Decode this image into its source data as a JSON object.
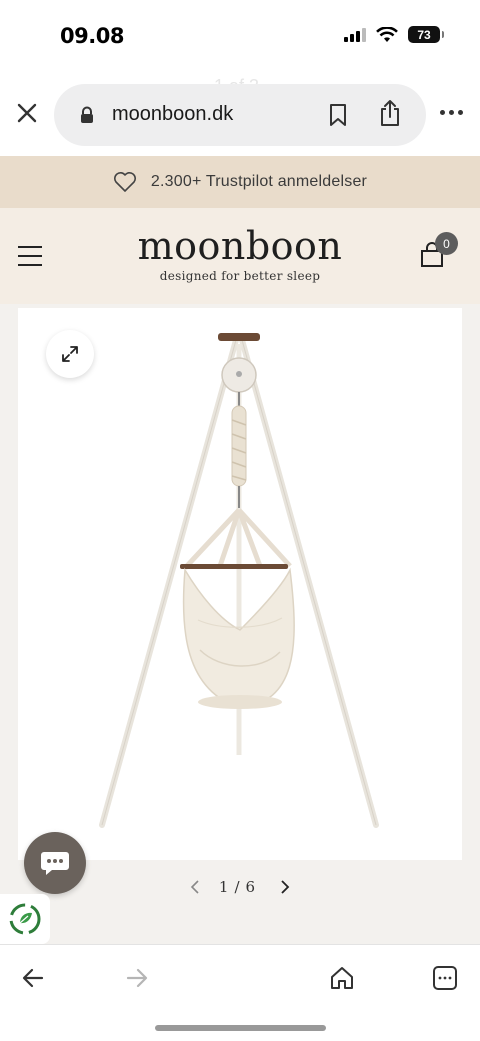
{
  "status": {
    "time": "09.08",
    "battery": "73"
  },
  "browser": {
    "ghost_tab": "1 af 3",
    "url": "moonboon.dk",
    "icons": [
      "close-icon",
      "lock-icon",
      "bookmark-icon",
      "share-icon",
      "more-icon"
    ]
  },
  "announcement": {
    "text": "2.300+ Trustpilot anmeldelser",
    "icon": "heart-icon"
  },
  "header": {
    "logo": "moonboon",
    "tagline": "designed for better sleep",
    "cart_count": "0"
  },
  "gallery": {
    "current": "1",
    "separator": "/",
    "total": "6"
  },
  "colors": {
    "announcement_bg": "#e9dccb",
    "header_bg": "#f4ede4",
    "chat_button": "#6a625c"
  }
}
